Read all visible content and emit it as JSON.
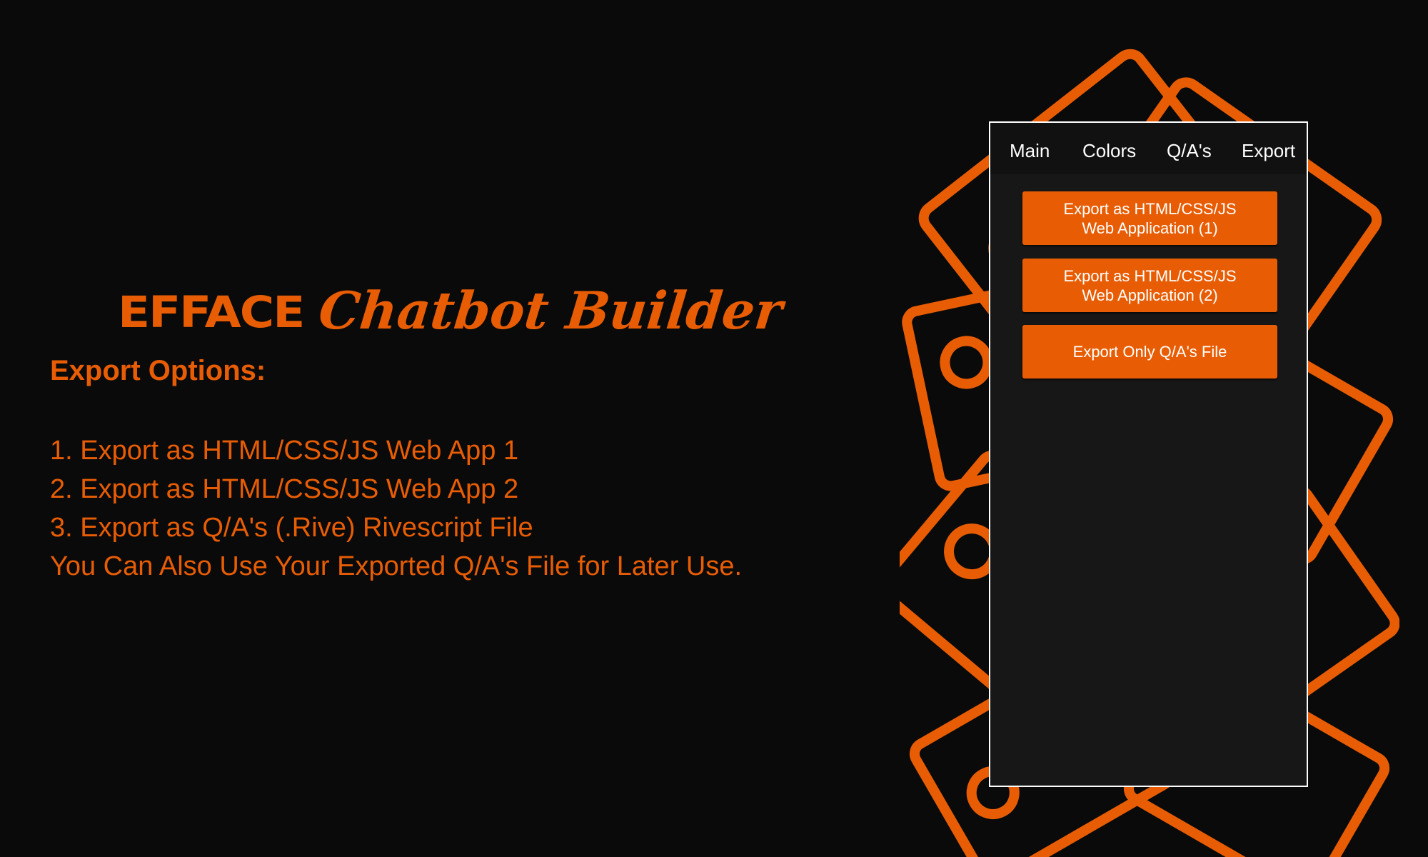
{
  "title": {
    "brand": "EFFACE",
    "script": "Chatbot Builder"
  },
  "options": {
    "heading": "Export Options:",
    "lines": [
      "1. Export as HTML/CSS/JS Web App 1",
      "2. Export as HTML/CSS/JS Web App 2",
      "3. Export as Q/A's (.Rive) Rivescript File",
      "You Can Also Use Your Exported Q/A's File for Later Use."
    ]
  },
  "app": {
    "tabs": [
      "Main",
      "Colors",
      "Q/A's",
      "Export"
    ],
    "buttons": [
      {
        "line1": "Export as HTML/CSS/JS",
        "line2": "Web Application (1)"
      },
      {
        "line1": "Export as HTML/CSS/JS",
        "line2": "Web Application (2)"
      },
      {
        "line1": "Export Only Q/A's File",
        "line2": ""
      }
    ]
  },
  "colors": {
    "accent": "#e85d04",
    "background": "#0a0a0a",
    "panel": "#171717",
    "tab_bar": "#111111",
    "text_light": "#ffffff"
  },
  "decoration": {
    "icon": "tag-outline-icon"
  }
}
